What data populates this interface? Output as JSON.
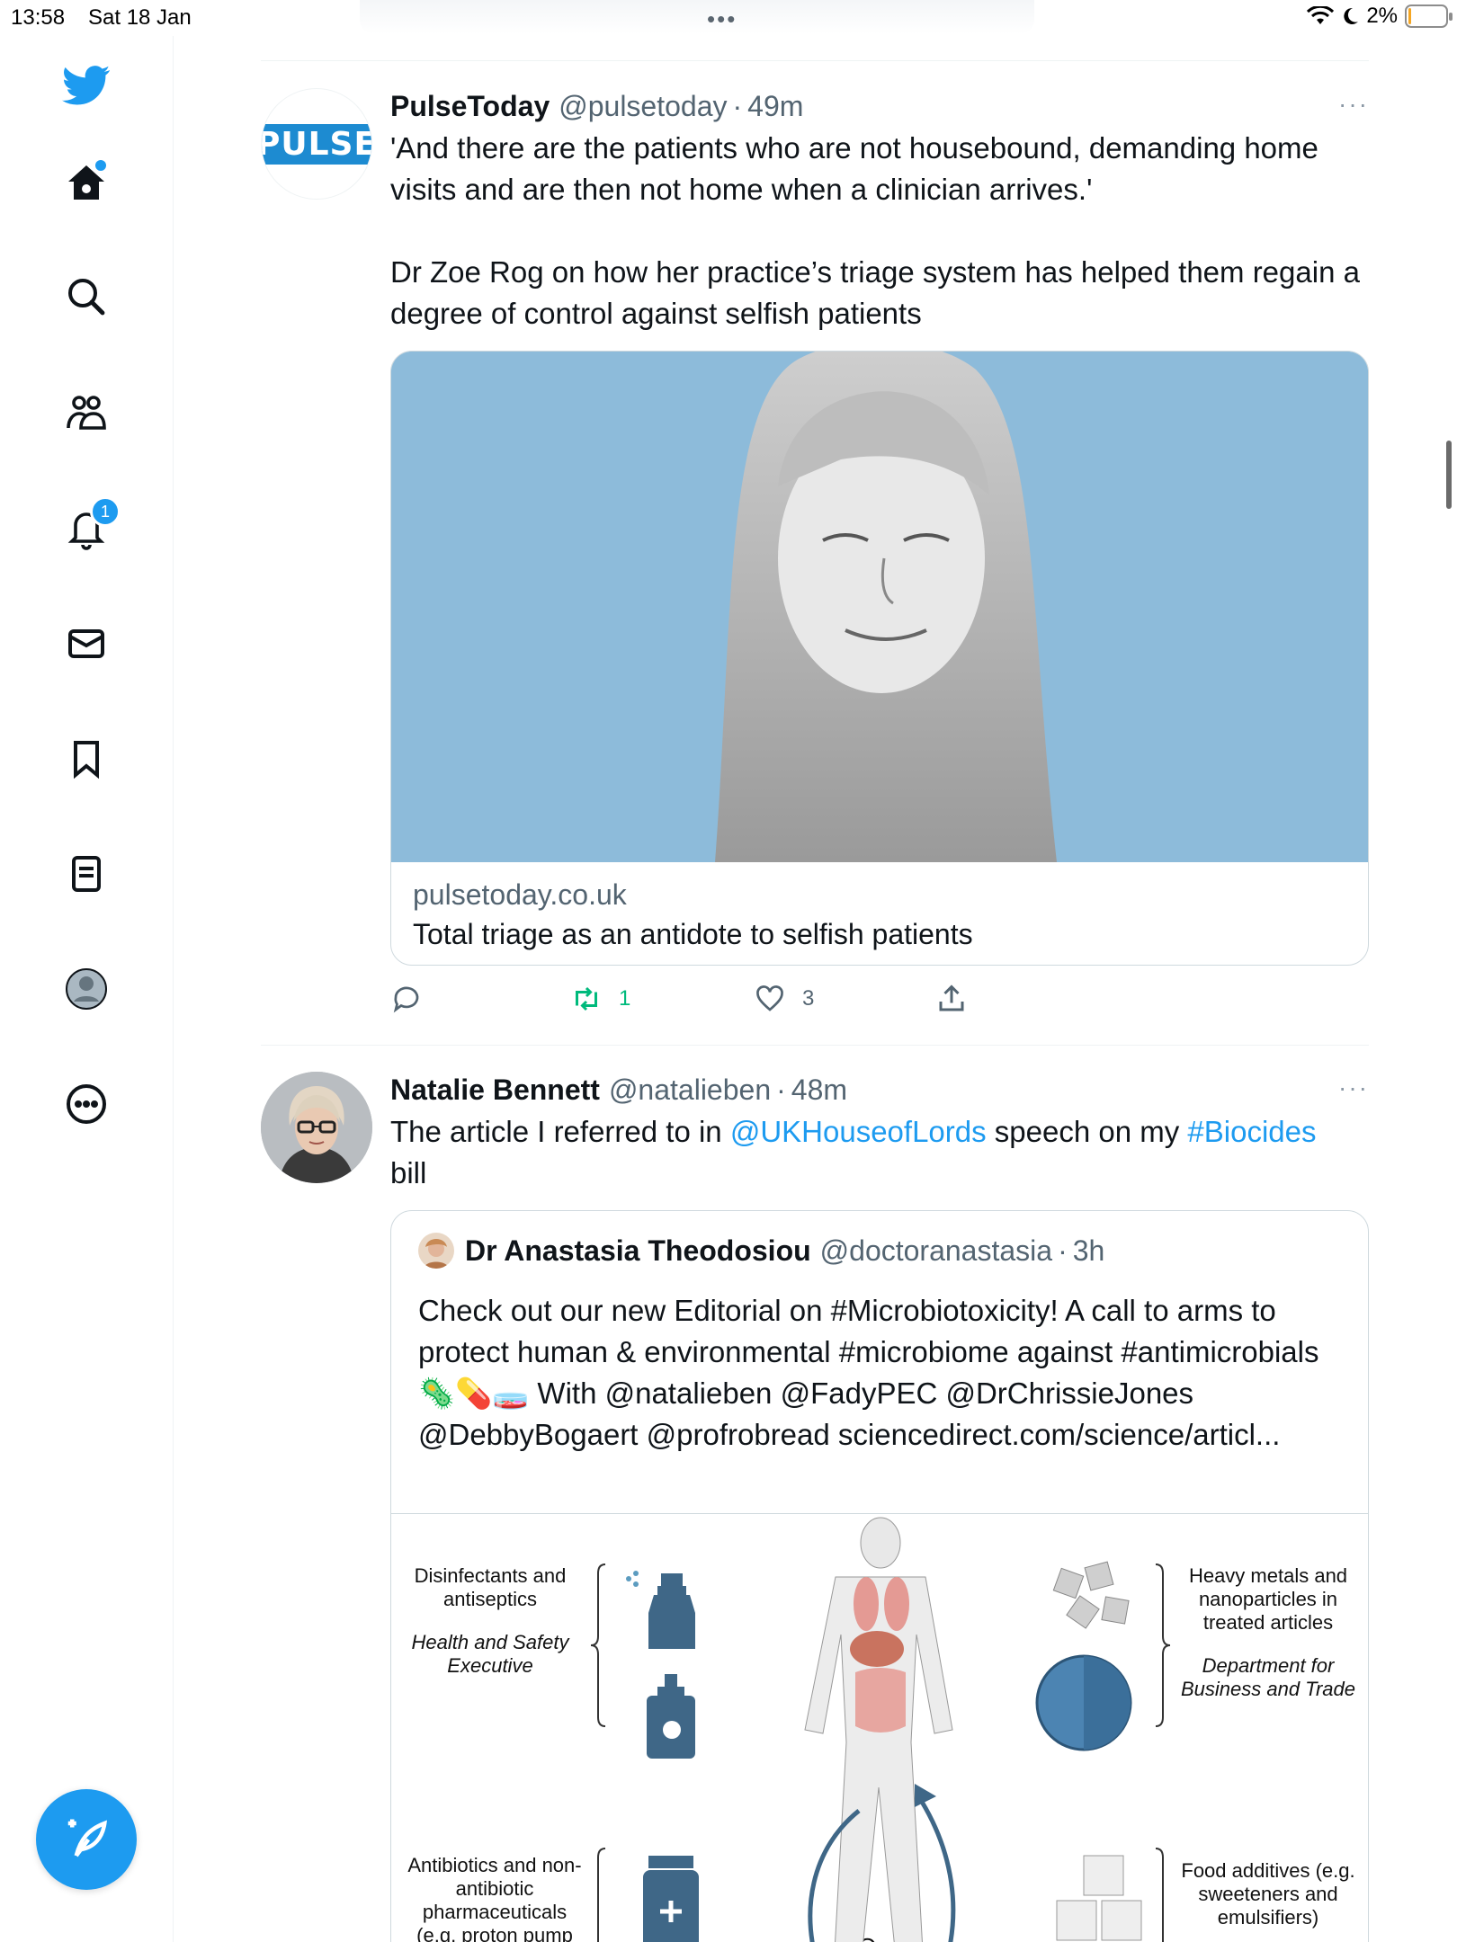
{
  "status_bar": {
    "time": "13:58",
    "date": "Sat 18 Jan",
    "dots": "•••",
    "battery": "2%"
  },
  "sidebar": {
    "items": [
      {
        "name": "twitter-logo-icon"
      },
      {
        "name": "home-icon"
      },
      {
        "name": "search-icon"
      },
      {
        "name": "communities-icon"
      },
      {
        "name": "notifications-icon",
        "badge": "1"
      },
      {
        "name": "messages-icon"
      },
      {
        "name": "bookmarks-icon"
      },
      {
        "name": "lists-icon"
      },
      {
        "name": "profile-icon"
      },
      {
        "name": "more-icon"
      }
    ],
    "compose_icon": "compose-icon"
  },
  "tweets": [
    {
      "author": "PulseToday",
      "handle": "@pulsetoday",
      "separator": "·",
      "time": "49m",
      "more": "···",
      "avatar_text": "PULSE",
      "text": "'And there are the patients who are not housebound, demanding home visits and are then not home when a clinician arrives.'\n\nDr Zoe Rog on how her practice’s triage system has helped them regain a degree of control against selfish patients",
      "card": {
        "domain": "pulsetoday.co.uk",
        "title": "Total triage as an antidote to selfish patients"
      },
      "actions": {
        "replies": "",
        "retweets": "1",
        "likes": "3"
      }
    },
    {
      "author": "Natalie Bennett",
      "handle": "@natalieben",
      "separator": "·",
      "time": "48m",
      "more": "···",
      "text_parts": [
        "The article I referred to in ",
        "@UKHouseofLords",
        " speech on my ",
        "#Biocides",
        "\nbill"
      ],
      "quote": {
        "author": "Dr Anastasia Theodosiou",
        "handle": "@doctoranastasia",
        "separator": "·",
        "time": "3h",
        "text": "Check out our new Editorial on #Microbiotoxicity! A call to arms to protect human & environmental #microbiome against #antimicrobials 🦠💊🧫 With @natalieben @FadyPEC @DrChrissieJones @DebbyBogaert @profrobread sciencedirect.com/science/articl...",
        "infographic": {
          "top_left_title": "Disinfectants and antiseptics",
          "top_left_agency": "Health and Safety Executive",
          "top_right_title": "Heavy metals and nanoparticles in treated articles",
          "top_right_agency": "Department for Business and Trade",
          "bottom_left_title": "Antibiotics and non-antibiotic pharmaceuticals (e.g. proton pump",
          "bottom_right_title": "Food additives (e.g. sweeteners and emulsifiers)",
          "center_label": "One"
        }
      }
    }
  ],
  "colors": {
    "accent": "#1d9bf0",
    "retweet": "#00ba7c",
    "muted": "#536471",
    "card_bg": "#8dbbda"
  }
}
